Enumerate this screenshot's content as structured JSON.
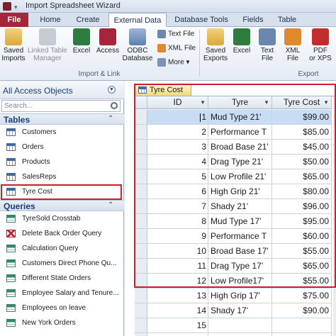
{
  "window": {
    "title": "Import Spreadsheet Wizard"
  },
  "ribbon_tabs": [
    "File",
    "Home",
    "Create",
    "External Data",
    "Database Tools",
    "Fields",
    "Table"
  ],
  "ribbon": {
    "import_link": {
      "buttons": [
        {
          "label": "Saved\nImports",
          "icon": "saved-imports-icon"
        },
        {
          "label": "Linked Table\nManager",
          "icon": "linked-table-icon"
        },
        {
          "label": "Excel",
          "icon": "excel-icon"
        },
        {
          "label": "Access",
          "icon": "access-icon"
        },
        {
          "label": "ODBC\nDatabase",
          "icon": "odbc-icon"
        }
      ],
      "small": [
        "Text File",
        "XML File",
        "More ▾"
      ],
      "group_label": "Import & Link"
    },
    "export": {
      "buttons": [
        {
          "label": "Saved\nExports",
          "icon": "saved-exports-icon"
        },
        {
          "label": "Excel",
          "icon": "excel-icon"
        },
        {
          "label": "Text\nFile",
          "icon": "text-file-icon"
        },
        {
          "label": "XML\nFile",
          "icon": "xml-file-icon"
        },
        {
          "label": "PDF\nor XPS",
          "icon": "pdf-icon"
        }
      ],
      "group_label": "Export"
    }
  },
  "nav": {
    "header": "All Access Objects",
    "search_placeholder": "Search...",
    "tables_label": "Tables",
    "tables": [
      "Customers",
      "Orders",
      "Products",
      "SalesReps",
      "Tyre Cost"
    ],
    "queries_label": "Queries",
    "queries": [
      "TyreSold Crosstab",
      "Delete Back Order Query",
      "Calculation Query",
      "Customers Direct Phone Qu...",
      "Different State Orders",
      "Employee Salary and Tenure...",
      "Employees on leave",
      "New York Orders"
    ]
  },
  "datasheet": {
    "tab_title": "Tyre Cost",
    "columns": [
      "ID",
      "Tyre",
      "Tyre Cost"
    ],
    "rows": [
      [
        "1",
        "Mud Type 21'",
        "$99.00"
      ],
      [
        "2",
        "Performance T",
        "$85.00"
      ],
      [
        "3",
        "Broad Base 21'",
        "$45.00"
      ],
      [
        "4",
        "Drag Type 21'",
        "$50.00"
      ],
      [
        "5",
        "Low Profile 21'",
        "$65.00"
      ],
      [
        "6",
        "High Grip 21'",
        "$80.00"
      ],
      [
        "7",
        "Shady 21'",
        "$96.00"
      ],
      [
        "8",
        "Mud Type 17'",
        "$95.00"
      ],
      [
        "9",
        "Performance T",
        "$60.00"
      ],
      [
        "10",
        "Broad Base 17'",
        "$55.00"
      ],
      [
        "11",
        "Drag Type 17'",
        "$65.00"
      ],
      [
        "12",
        "Low Profile17'",
        "$55.00"
      ],
      [
        "13",
        "High Grip 17'",
        "$75.00"
      ],
      [
        "14",
        "Shady 17'",
        "$90.00"
      ],
      [
        "15",
        "",
        ""
      ]
    ],
    "new_row_marker": "*",
    "new_row_label": "(New)"
  },
  "colors": {
    "file_tab": "#a5263a",
    "highlight": "#d21b2b",
    "selected_row": "#c8ddf3"
  }
}
